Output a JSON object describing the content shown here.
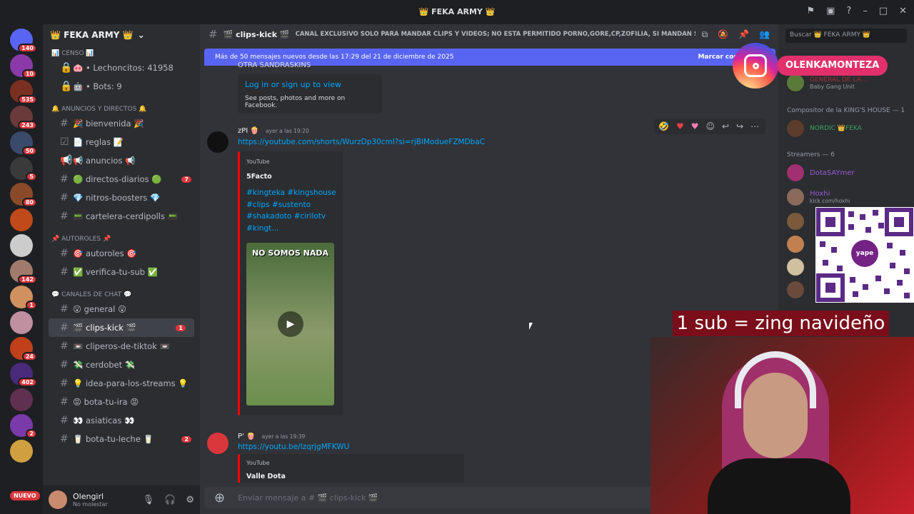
{
  "window": {
    "title": "👑 FEKA ARMY 👑"
  },
  "servers": [
    {
      "badge": "140",
      "color": "#5865f2"
    },
    {
      "badge": "10",
      "color": "#8a3aa8"
    },
    {
      "badge": "535",
      "color": "#7a3020"
    },
    {
      "badge": "243",
      "color": "#6a3a3a"
    },
    {
      "badge": "50",
      "color": "#3a4a6a"
    },
    {
      "badge": "5",
      "color": "#3a3a3a"
    },
    {
      "badge": "80",
      "color": "#8a4a2a"
    },
    {
      "badge": "",
      "color": "#c04a1a"
    },
    {
      "badge": "",
      "color": "#cccccc"
    },
    {
      "badge": "142",
      "color": "#a07a6a"
    },
    {
      "badge": "1",
      "color": "#d09060"
    },
    {
      "badge": "",
      "color": "#c090a0"
    },
    {
      "badge": "24",
      "color": "#c0401a"
    },
    {
      "badge": "402",
      "color": "#4a2a7a"
    },
    {
      "badge": "",
      "color": "#603050"
    },
    {
      "badge": "2",
      "color": "#7a3aaa"
    },
    {
      "badge": "",
      "color": "#d0a040"
    }
  ],
  "server_list": {
    "new_badge": "NUEVO"
  },
  "guild": {
    "name": "👑 FEKA ARMY 👑"
  },
  "channels": {
    "cat_censo": "📊 CENSO 📊",
    "lechoncitos": "🐽 • Lechoncitos: 41958",
    "bots": "🤖 • Bots: 9",
    "cat_anuncios": "🔔 ANUNCIOS Y DIRECTOS 🔔",
    "bienvenida": "🎉 bienvenida 🎉",
    "reglas": "📄 reglas 📝",
    "anuncios": "📢 anuncios 📢",
    "directos": "🟢 directos-diarios 🟢",
    "directos_badge": "7",
    "nitros": "💎 nitros-boosters 💎",
    "cartelera": "📟 cartelera-cerdipolls 📟",
    "cat_autoroles": "📌 AUTOROLES 📌",
    "autoroles": "🎯 autoroles 🎯",
    "verifica": "✅ verifica-tu-sub ✅",
    "cat_chat": "💬 CANALES DE CHAT 💬",
    "general": "😮 general 😮",
    "clips": "🎬 clips-kick 🎬",
    "clips_badge": "1",
    "cliperos": "📼 cliperos-de-tiktok 📼",
    "cerdobet": "💸 cerdobet 💸",
    "idea": "💡 idea-para-los-streams 💡",
    "bota": "😡 bota-tu-ira 😡",
    "asiaticas": "👀 asiaticas 👀",
    "leche": "🥛 bota-tu-leche 🥛",
    "leche_badge": "2"
  },
  "user": {
    "name": "Olengirl",
    "status": "No molestar"
  },
  "header": {
    "channel": "🎬 clips-kick 🎬",
    "topic": "CANAL EXCLUSIVO SOLO PARA MANDAR CLIPS Y VIDEOS; NO ESTA PERMITIDO PORNO,GORE,CP,ZOFILIA, SI MANDAN S...",
    "search_placeholder": "Buscar 👑 FEKA ARMY 👑"
  },
  "new_messages": {
    "text": "Más de 50 mensajes nuevos desde las 17:29 del 21 de diciembre de 2025",
    "mark": "Marcar como leído"
  },
  "messages": [
    {
      "partial_top": "OTRA SANDRASKINS",
      "fb_link": "Log in or sign up to view",
      "fb_desc": "See posts, photos and more on Facebook."
    },
    {
      "author": "zPI 🍿",
      "time": "ayer a las 19:20",
      "link": "https://youtube.com/shorts/WurzDp30cmI?si=rjBlModueFZMDbaC",
      "embed_provider": "YouTube",
      "embed_title": "5Facto",
      "embed_lines": [
        "#kingteka #kingshouse",
        "#clips  #sustento",
        "#shakadoto #cirilotv",
        "#kingt..."
      ],
      "thumb_caption": "NO SOMOS NADA"
    },
    {
      "author": "P' 🍿",
      "time": "ayer a las 19:39",
      "link": "https://youtu.be/lzqrjgMFKWU",
      "embed_provider": "YouTube",
      "embed_title": "Valle Dota"
    }
  ],
  "composer": {
    "placeholder": "Enviar mensaje a # 🎬 clips-kick 🎬"
  },
  "members": {
    "group1_member": "GENERAL DE LA...",
    "group1_sub": "Baby Gang Unit",
    "group2": "Compositor de la KING'S HOUSE — 1",
    "member2": "NORDIC 👑FEKA",
    "group3": "Streamers — 6",
    "streamer1": "DotaSAYmer",
    "streamer2": "Hoxhi",
    "streamer2_sub": "kick.com/hoxhi"
  },
  "overlay": {
    "instagram": "OLENKAMONTEZA",
    "sub_text": "1 sub = zing navideño",
    "qr_brand": "yape"
  },
  "colors": {
    "accent": "#5865f2",
    "link": "#00a8fc",
    "badge": "#da373c",
    "bg": "#313338"
  }
}
